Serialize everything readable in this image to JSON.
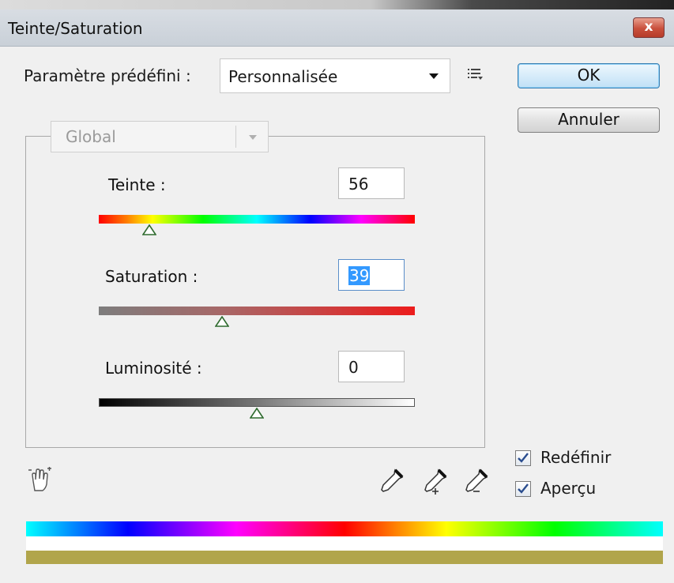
{
  "dialog": {
    "title": "Teinte/Saturation",
    "close_glyph": "x"
  },
  "preset": {
    "label": "Paramètre prédéfini :",
    "value": "Personnalisée",
    "menu_icon": "list-options-icon"
  },
  "buttons": {
    "ok": "OK",
    "cancel": "Annuler"
  },
  "channel": {
    "value": "Global"
  },
  "adjustments": [
    {
      "label": "Teinte :",
      "value": "56",
      "slider_position": 0.16
    },
    {
      "label": "Saturation :",
      "value": "39",
      "slider_position": 0.39
    },
    {
      "label": "Luminosité :",
      "value": "0",
      "slider_position": 0.5
    }
  ],
  "tools": [
    "targeted-adjust-hand-icon",
    "eyedropper-icon",
    "eyedropper-add-icon",
    "eyedropper-subtract-icon"
  ],
  "options": {
    "redefine": {
      "label": "Redéfinir",
      "checked": true
    },
    "preview": {
      "label": "Aperçu",
      "checked": true
    }
  },
  "colors": {
    "accent": "#3399ff",
    "shifted_bar": "#b1a54b",
    "thumb_stroke": "#2f6b2f"
  }
}
